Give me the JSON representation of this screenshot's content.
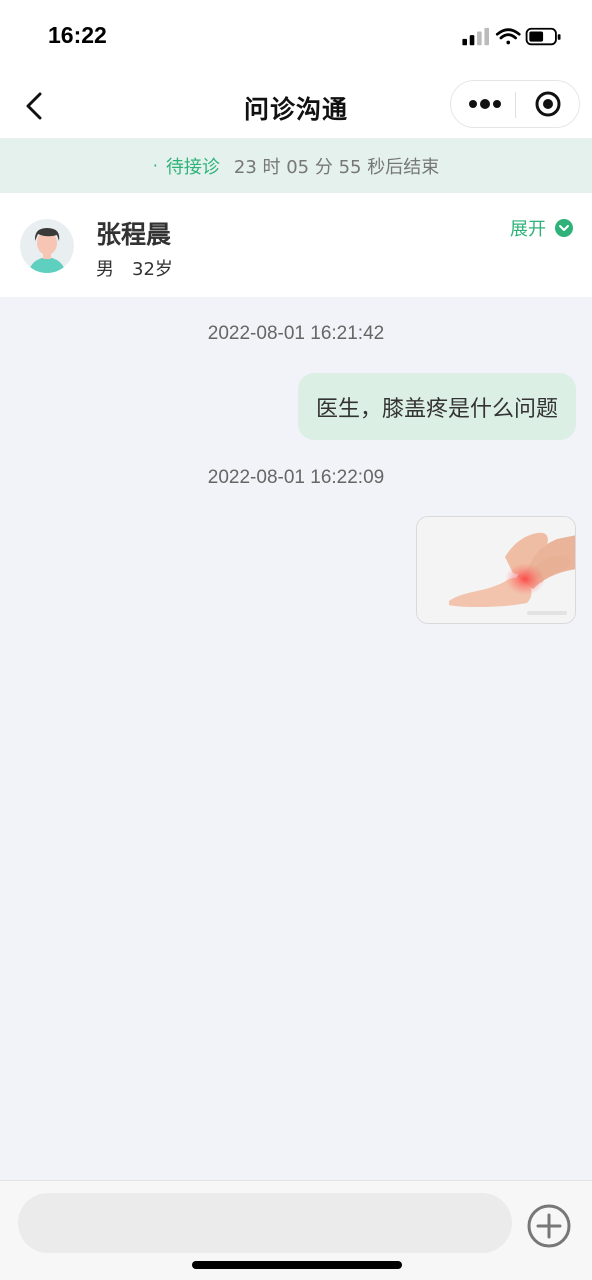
{
  "status_bar": {
    "time": "16:22"
  },
  "nav": {
    "title": "问诊沟通"
  },
  "countdown": {
    "dot": "·",
    "status": "待接诊",
    "remaining": "23 时 05 分 55 秒后结束"
  },
  "patient": {
    "name": "张程晨",
    "gender": "男",
    "age": "32岁",
    "expand_label": "展开"
  },
  "messages": [
    {
      "timestamp": "2022-08-01 16:21:42",
      "type": "text",
      "text": "医生，膝盖疼是什么问题"
    },
    {
      "timestamp": "2022-08-01 16:22:09",
      "type": "image"
    }
  ],
  "input": {
    "placeholder": ""
  },
  "colors": {
    "accent": "#2fb27a",
    "banner_bg": "#e4f1ec",
    "bubble_bg": "#dcefe5",
    "chat_bg": "#f2f3f8"
  }
}
